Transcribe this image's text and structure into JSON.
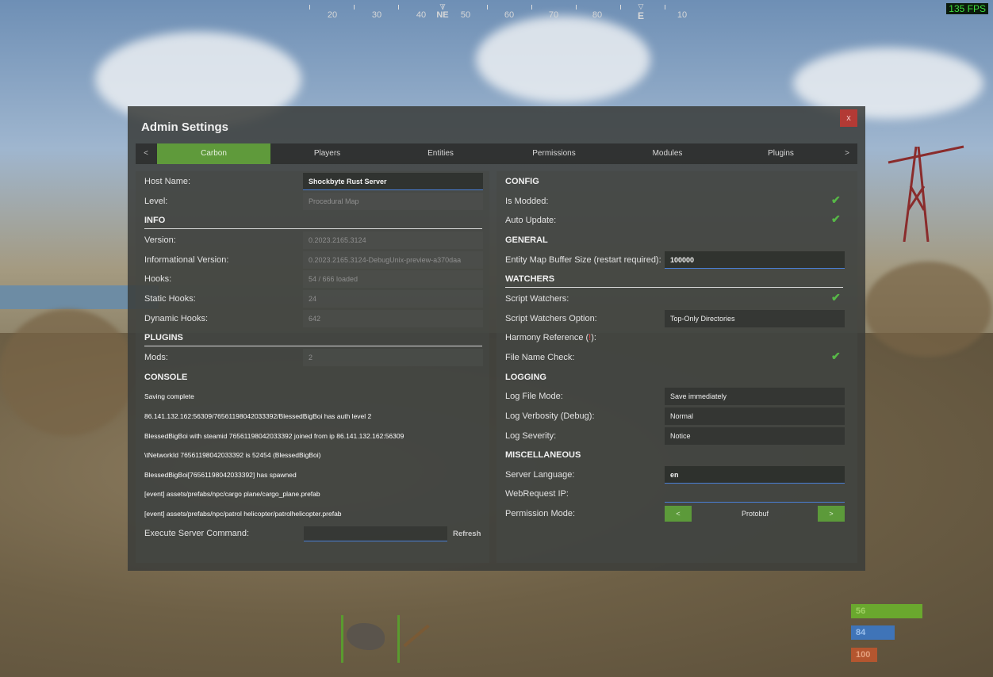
{
  "compass": {
    "numbers": [
      "20",
      "30",
      "40",
      "50",
      "60",
      "70",
      "80",
      "10"
    ],
    "markers": [
      "NE",
      "E"
    ]
  },
  "fps": "135 FPS",
  "window": {
    "title": "Admin Settings",
    "close_label": "x"
  },
  "tabs": {
    "prev_label": "<",
    "next_label": ">",
    "items": [
      "Carbon",
      "Players",
      "Entities",
      "Permissions",
      "Modules",
      "Plugins"
    ],
    "active": "Carbon"
  },
  "left": {
    "host_name_label": "Host Name:",
    "host_name_value": "Shockbyte Rust Server",
    "level_label": "Level:",
    "level_value": "Procedural Map",
    "info_header": "INFO",
    "version_label": "Version:",
    "version_value": "0.2023.2165.3124",
    "info_version_label": "Informational Version:",
    "info_version_value": "0.2023.2165.3124-DebugUnix-preview-a370daa",
    "hooks_label": "Hooks:",
    "hooks_value": "54 / 666 loaded",
    "static_hooks_label": "Static Hooks:",
    "static_hooks_value": "24",
    "dynamic_hooks_label": "Dynamic Hooks:",
    "dynamic_hooks_value": "642",
    "plugins_header": "PLUGINS",
    "mods_label": "Mods:",
    "mods_value": "2",
    "console_header": "CONSOLE",
    "console_lines": [
      "Saving complete",
      "86.141.132.162:56309/76561198042033392/BlessedBigBoi has auth level 2",
      "BlessedBigBoi with steamid 76561198042033392 joined from ip 86.141.132.162:56309",
      "\\tNetworkId 76561198042033392 is 52454 (BlessedBigBoi)",
      "BlessedBigBoi[76561198042033392] has spawned",
      "[event] assets/prefabs/npc/cargo plane/cargo_plane.prefab",
      "[event] assets/prefabs/npc/patrol helicopter/patrolhelicopter.prefab"
    ],
    "command_label": "Execute Server Command:",
    "refresh_label": "Refresh"
  },
  "right": {
    "config_header": "CONFIG",
    "is_modded_label": "Is Modded:",
    "auto_update_label": "Auto Update:",
    "general_header": "GENERAL",
    "entity_map_label": "Entity Map Buffer Size (restart required):",
    "entity_map_value": "100000",
    "watchers_header": "WATCHERS",
    "script_watchers_label": "Script Watchers:",
    "script_watchers_option_label": "Script Watchers Option:",
    "script_watchers_option_value": "Top-Only Directories",
    "harmony_label_a": "Harmony Reference (",
    "harmony_label_hl": "!",
    "harmony_label_b": "):",
    "file_name_check_label": "File Name Check:",
    "logging_header": "LOGGING",
    "log_file_mode_label": "Log File Mode:",
    "log_file_mode_value": "Save immediately",
    "log_verbosity_label": "Log Verbosity (Debug):",
    "log_verbosity_value": "Normal",
    "log_severity_label": "Log Severity:",
    "log_severity_value": "Notice",
    "misc_header": "MISCELLANEOUS",
    "server_language_label": "Server Language:",
    "server_language_value": "en",
    "webrequest_ip_label": "WebRequest IP:",
    "webrequest_ip_value": "",
    "permission_mode_label": "Permission Mode:",
    "permission_mode_value": "Protobuf",
    "perm_prev": "<",
    "perm_next": ">"
  },
  "hud": {
    "health": "56",
    "hydration": "84",
    "food": "100",
    "health_color": "#6aa82e",
    "hydration_color": "#3f74b8",
    "food_color": "#b4562f"
  }
}
